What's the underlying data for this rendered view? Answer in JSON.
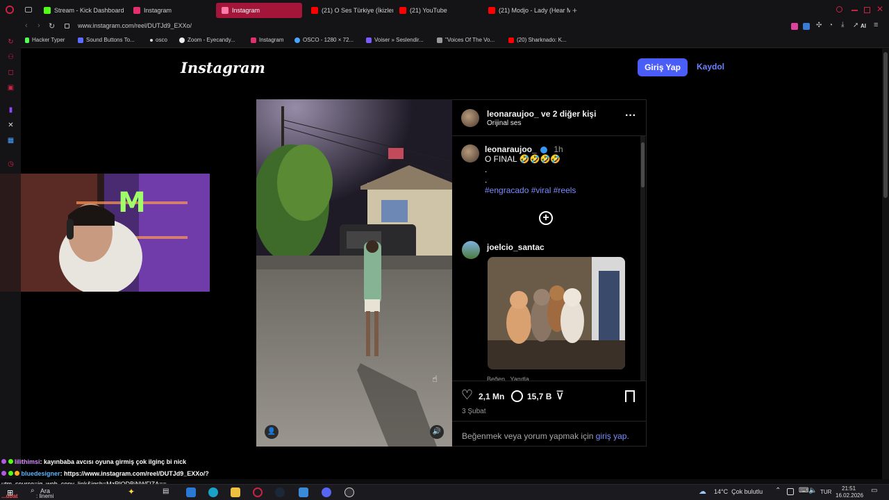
{
  "browser": {
    "tabs": [
      {
        "label": "Stream - Kick Dashboard",
        "color": "#53fc18"
      },
      {
        "label": "Instagram",
        "color": "#e1306c"
      },
      {
        "label": "Instagram",
        "color": "#e1306c",
        "active": true
      },
      {
        "label": "(21) O Ses Türkiye (İkizler",
        "color": "#ff0000"
      },
      {
        "label": "(21) YouTube",
        "color": "#ff0000"
      },
      {
        "label": "(21) Modjo - Lady (Hear M",
        "color": "#ff0000"
      }
    ],
    "url": "www.instagram.com/reel/DUTJd9_EXXo/",
    "ai_label": "AI",
    "bookmarks": [
      "Hacker Typer",
      "Sound Buttons To...",
      "osco",
      "Zoom - Eyecandy...",
      "Instagram",
      "OSCO - 1280 × 72...",
      "Voiser » Seslendir...",
      "\"Voices Of The Vo...",
      "(20) Sharknado: K..."
    ]
  },
  "instagram": {
    "logo": "Instagram",
    "login_label": "Giriş Yap",
    "signup_label": "Kaydol",
    "post": {
      "header_user": "leonaraujoo_",
      "header_and_others": "ve 2 diğer kişi",
      "audio": "Orijinal ses",
      "caption_user": "leonaraujoo_",
      "caption_time": "1h",
      "caption_text": "O FINAL 🤣🤣🤣🤣",
      "caption_dot1": ".",
      "caption_dot2": ".",
      "hashtags": "#engracado #viral #reels",
      "comment_user": "joelcio_santac",
      "comment_actions": "Beğen   Yanıtla",
      "likes": "2,1 Mn",
      "comments": "15,7 B",
      "date": "3 Şubat",
      "prompt_prefix": "Beğenmek veya yorum yapmak için",
      "prompt_link": "giriş yap."
    }
  },
  "chat": [
    {
      "user": "lilithimsi",
      "user_color": "#d98cff",
      "text": ": kayınbaba avcısı oyuna girmiş çok ilginç bi nick"
    },
    {
      "user": "bluedesigner",
      "user_color": "#55b6ff",
      "text": ": https://www.instagram.com/reel/DUTJd9_EXXo/?"
    },
    {
      "user": "",
      "user_color": "#ffffff",
      "text": "utm_source=ig_web_copy_link&igsh=MzRlODBiNWFlZA=="
    },
    {
      "user": "...ubat",
      "user_color": "#ff4d4d",
      "text": ": linemi"
    }
  ],
  "taskbar": {
    "search": "Ara",
    "weather": "14°C  Çok bulutlu",
    "lang": "TUR",
    "time": "21:51",
    "date": "16.02.2026"
  }
}
